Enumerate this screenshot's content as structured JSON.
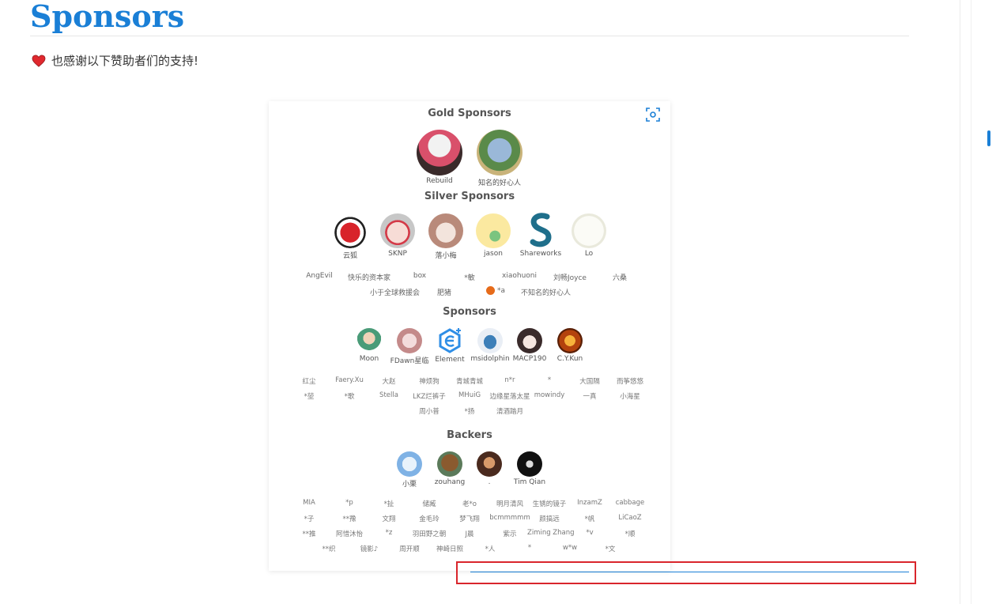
{
  "page": {
    "title": "Sponsors",
    "thanks_text": "也感谢以下赞助者们的支持!"
  },
  "sections": {
    "gold": "Gold Sponsors",
    "silver": "Silver Sponsors",
    "sponsors": "Sponsors",
    "backers": "Backers"
  },
  "gold_sponsors": [
    "Rebuild",
    "知名的好心人"
  ],
  "silver_sponsors": [
    "云狐",
    "SKNP",
    "落小梅",
    "jason",
    "Shareworks",
    "Lo"
  ],
  "silver_text_row1": [
    "AngEvil",
    "快乐的资本家",
    "box",
    "*敏",
    "xiaohuoni",
    "刘畅Joyce",
    "六桑"
  ],
  "silver_text_row2": [
    "小于全球救援会",
    "肥猪",
    "*a",
    "不知名的好心人"
  ],
  "sponsors": [
    "Moon",
    "FDawn星临",
    "Element",
    "msidolphin",
    "MACP190",
    "C.Y.Kun"
  ],
  "sponsor_text_row1": [
    "红尘",
    "Faery.Xu",
    "大赵",
    "神烦狗",
    "青城青城",
    "n*r",
    "*",
    "大国隔",
    "而筝悠悠"
  ],
  "sponsor_text_row2": [
    "*堃",
    "*歌",
    "Stella",
    "LKZ烂裤子",
    "MHuiG",
    "边缘星落太星",
    "mowindy",
    "一真",
    "小海星"
  ],
  "sponsor_text_row3": [
    "周小普",
    "*扬",
    "清酒踏月"
  ],
  "backers": [
    "小栗",
    "zouhang",
    ".",
    "Tim Qian"
  ],
  "backer_text_row1": [
    "MIA",
    "*p",
    "*扯",
    "储臧",
    "老*o",
    "明月清风",
    "生锈的镜子",
    "InzamZ",
    "cabbage"
  ],
  "backer_text_row2": [
    "*子",
    "**豫",
    "文翔",
    "金毛玲",
    "梦飞翔",
    "bcmmmmm",
    "颜搞远",
    "*帆",
    "LiCaoZ"
  ],
  "backer_text_row3": [
    "**推",
    "阿惜沐怡",
    "*z",
    "羽田野之朝",
    "J晨",
    "紫示",
    "Ziming Zhang",
    "*v",
    "*顺"
  ],
  "backer_text_row4": [
    "**织",
    "镜影♪",
    "周开顺",
    "神崎日照",
    "*人",
    "*",
    "w*w",
    "*文"
  ],
  "colors": {
    "accent": "#1a7fd6",
    "highlight_box": "#d9262c"
  },
  "icons": {
    "heart": "heart-icon",
    "focus": "focus-icon"
  }
}
